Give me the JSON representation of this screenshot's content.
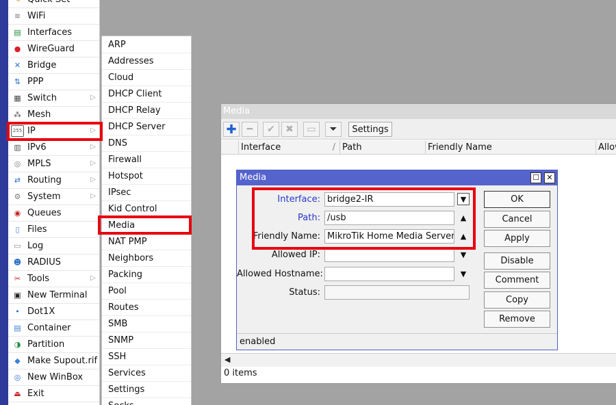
{
  "sidebar": {
    "items": [
      {
        "label": "Quick Set",
        "icon": "quick-set-icon",
        "glyph": "✎",
        "color": "#c98a1a",
        "arrow": false
      },
      {
        "label": "WiFi",
        "icon": "wifi-icon",
        "glyph": "≋",
        "color": "#7a7a7a",
        "arrow": false
      },
      {
        "label": "Interfaces",
        "icon": "interfaces-icon",
        "glyph": "▤",
        "color": "#1e8e3e",
        "arrow": false
      },
      {
        "label": "WireGuard",
        "icon": "wireguard-icon",
        "glyph": "●",
        "color": "#d9202c",
        "arrow": false
      },
      {
        "label": "Bridge",
        "icon": "bridge-icon",
        "glyph": "✕",
        "color": "#2a6fc9",
        "arrow": false
      },
      {
        "label": "PPP",
        "icon": "ppp-icon",
        "glyph": "⇅",
        "color": "#2a6fc9",
        "arrow": false
      },
      {
        "label": "Switch",
        "icon": "switch-icon",
        "glyph": "▦",
        "color": "#4a4a4a",
        "arrow": true
      },
      {
        "label": "Mesh",
        "icon": "mesh-icon",
        "glyph": "⁂",
        "color": "#4a4a4a",
        "arrow": false
      },
      {
        "label": "IP",
        "icon": "ip-icon",
        "glyph": "255",
        "color": "#555555",
        "arrow": true
      },
      {
        "label": "IPv6",
        "icon": "ipv6-icon",
        "glyph": "▥",
        "color": "#555555",
        "arrow": true
      },
      {
        "label": "MPLS",
        "icon": "mpls-icon",
        "glyph": "◎",
        "color": "#7a7a7a",
        "arrow": true
      },
      {
        "label": "Routing",
        "icon": "routing-icon",
        "glyph": "⇄",
        "color": "#2a6fc9",
        "arrow": true
      },
      {
        "label": "System",
        "icon": "system-icon",
        "glyph": "⚙",
        "color": "#7a7a7a",
        "arrow": true
      },
      {
        "label": "Queues",
        "icon": "queues-icon",
        "glyph": "◉",
        "color": "#c42020",
        "arrow": false
      },
      {
        "label": "Files",
        "icon": "files-icon",
        "glyph": "▯",
        "color": "#3f7fd6",
        "arrow": false
      },
      {
        "label": "Log",
        "icon": "log-icon",
        "glyph": "▭",
        "color": "#888888",
        "arrow": false
      },
      {
        "label": "RADIUS",
        "icon": "radius-icon",
        "glyph": "☻",
        "color": "#2a6fc9",
        "arrow": false
      },
      {
        "label": "Tools",
        "icon": "tools-icon",
        "glyph": "✂",
        "color": "#c42020",
        "arrow": true
      },
      {
        "label": "New Terminal",
        "icon": "terminal-icon",
        "glyph": "▣",
        "color": "#222222",
        "arrow": false
      },
      {
        "label": "Dot1X",
        "icon": "dot1x-icon",
        "glyph": "•",
        "color": "#2a6fc9",
        "arrow": false
      },
      {
        "label": "Container",
        "icon": "container-icon",
        "glyph": "▤",
        "color": "#3f7fd6",
        "arrow": false
      },
      {
        "label": "Partition",
        "icon": "partition-icon",
        "glyph": "◑",
        "color": "#1e8e3e",
        "arrow": false
      },
      {
        "label": "Make Supout.rif",
        "icon": "supout-icon",
        "glyph": "◆",
        "color": "#3f7fd6",
        "arrow": false
      },
      {
        "label": "New WinBox",
        "icon": "winbox-icon",
        "glyph": "◎",
        "color": "#2a6fc9",
        "arrow": false
      },
      {
        "label": "Exit",
        "icon": "exit-icon",
        "glyph": "⏏",
        "color": "#c42020",
        "arrow": false
      }
    ]
  },
  "submenu": {
    "items": [
      "ARP",
      "Addresses",
      "Cloud",
      "DHCP Client",
      "DHCP Relay",
      "DHCP Server",
      "DNS",
      "Firewall",
      "Hotspot",
      "IPsec",
      "Kid Control",
      "Media",
      "NAT PMP",
      "Neighbors",
      "Packing",
      "Pool",
      "Routes",
      "SMB",
      "SNMP",
      "SSH",
      "Services",
      "Settings",
      "Socks"
    ]
  },
  "media_list": {
    "title": "Media",
    "settings_label": "Settings",
    "columns": [
      "Interface",
      "Path",
      "Friendly Name",
      "Allow"
    ],
    "items_count": "0 items"
  },
  "dialog": {
    "title": "Media",
    "fields": {
      "interface": {
        "label": "Interface:",
        "value": "bridge2-IR"
      },
      "path": {
        "label": "Path:",
        "value": "/usb"
      },
      "friendly_name": {
        "label": "Friendly Name:",
        "value": "MikroTik Home Media Server"
      },
      "allowed_ip": {
        "label": "Allowed IP:",
        "value": ""
      },
      "allowed_hostname": {
        "label": "Allowed Hostname:",
        "value": ""
      },
      "status": {
        "label": "Status:",
        "value": ""
      }
    },
    "buttons": {
      "ok": "OK",
      "cancel": "Cancel",
      "apply": "Apply",
      "disable": "Disable",
      "comment": "Comment",
      "copy": "Copy",
      "remove": "Remove"
    },
    "status_bar": "enabled"
  },
  "colors": {
    "highlight": "#e8000d",
    "dialog_title": "#5563cc",
    "label_blue": "#2836c8",
    "strip": "#2f3b9a"
  }
}
